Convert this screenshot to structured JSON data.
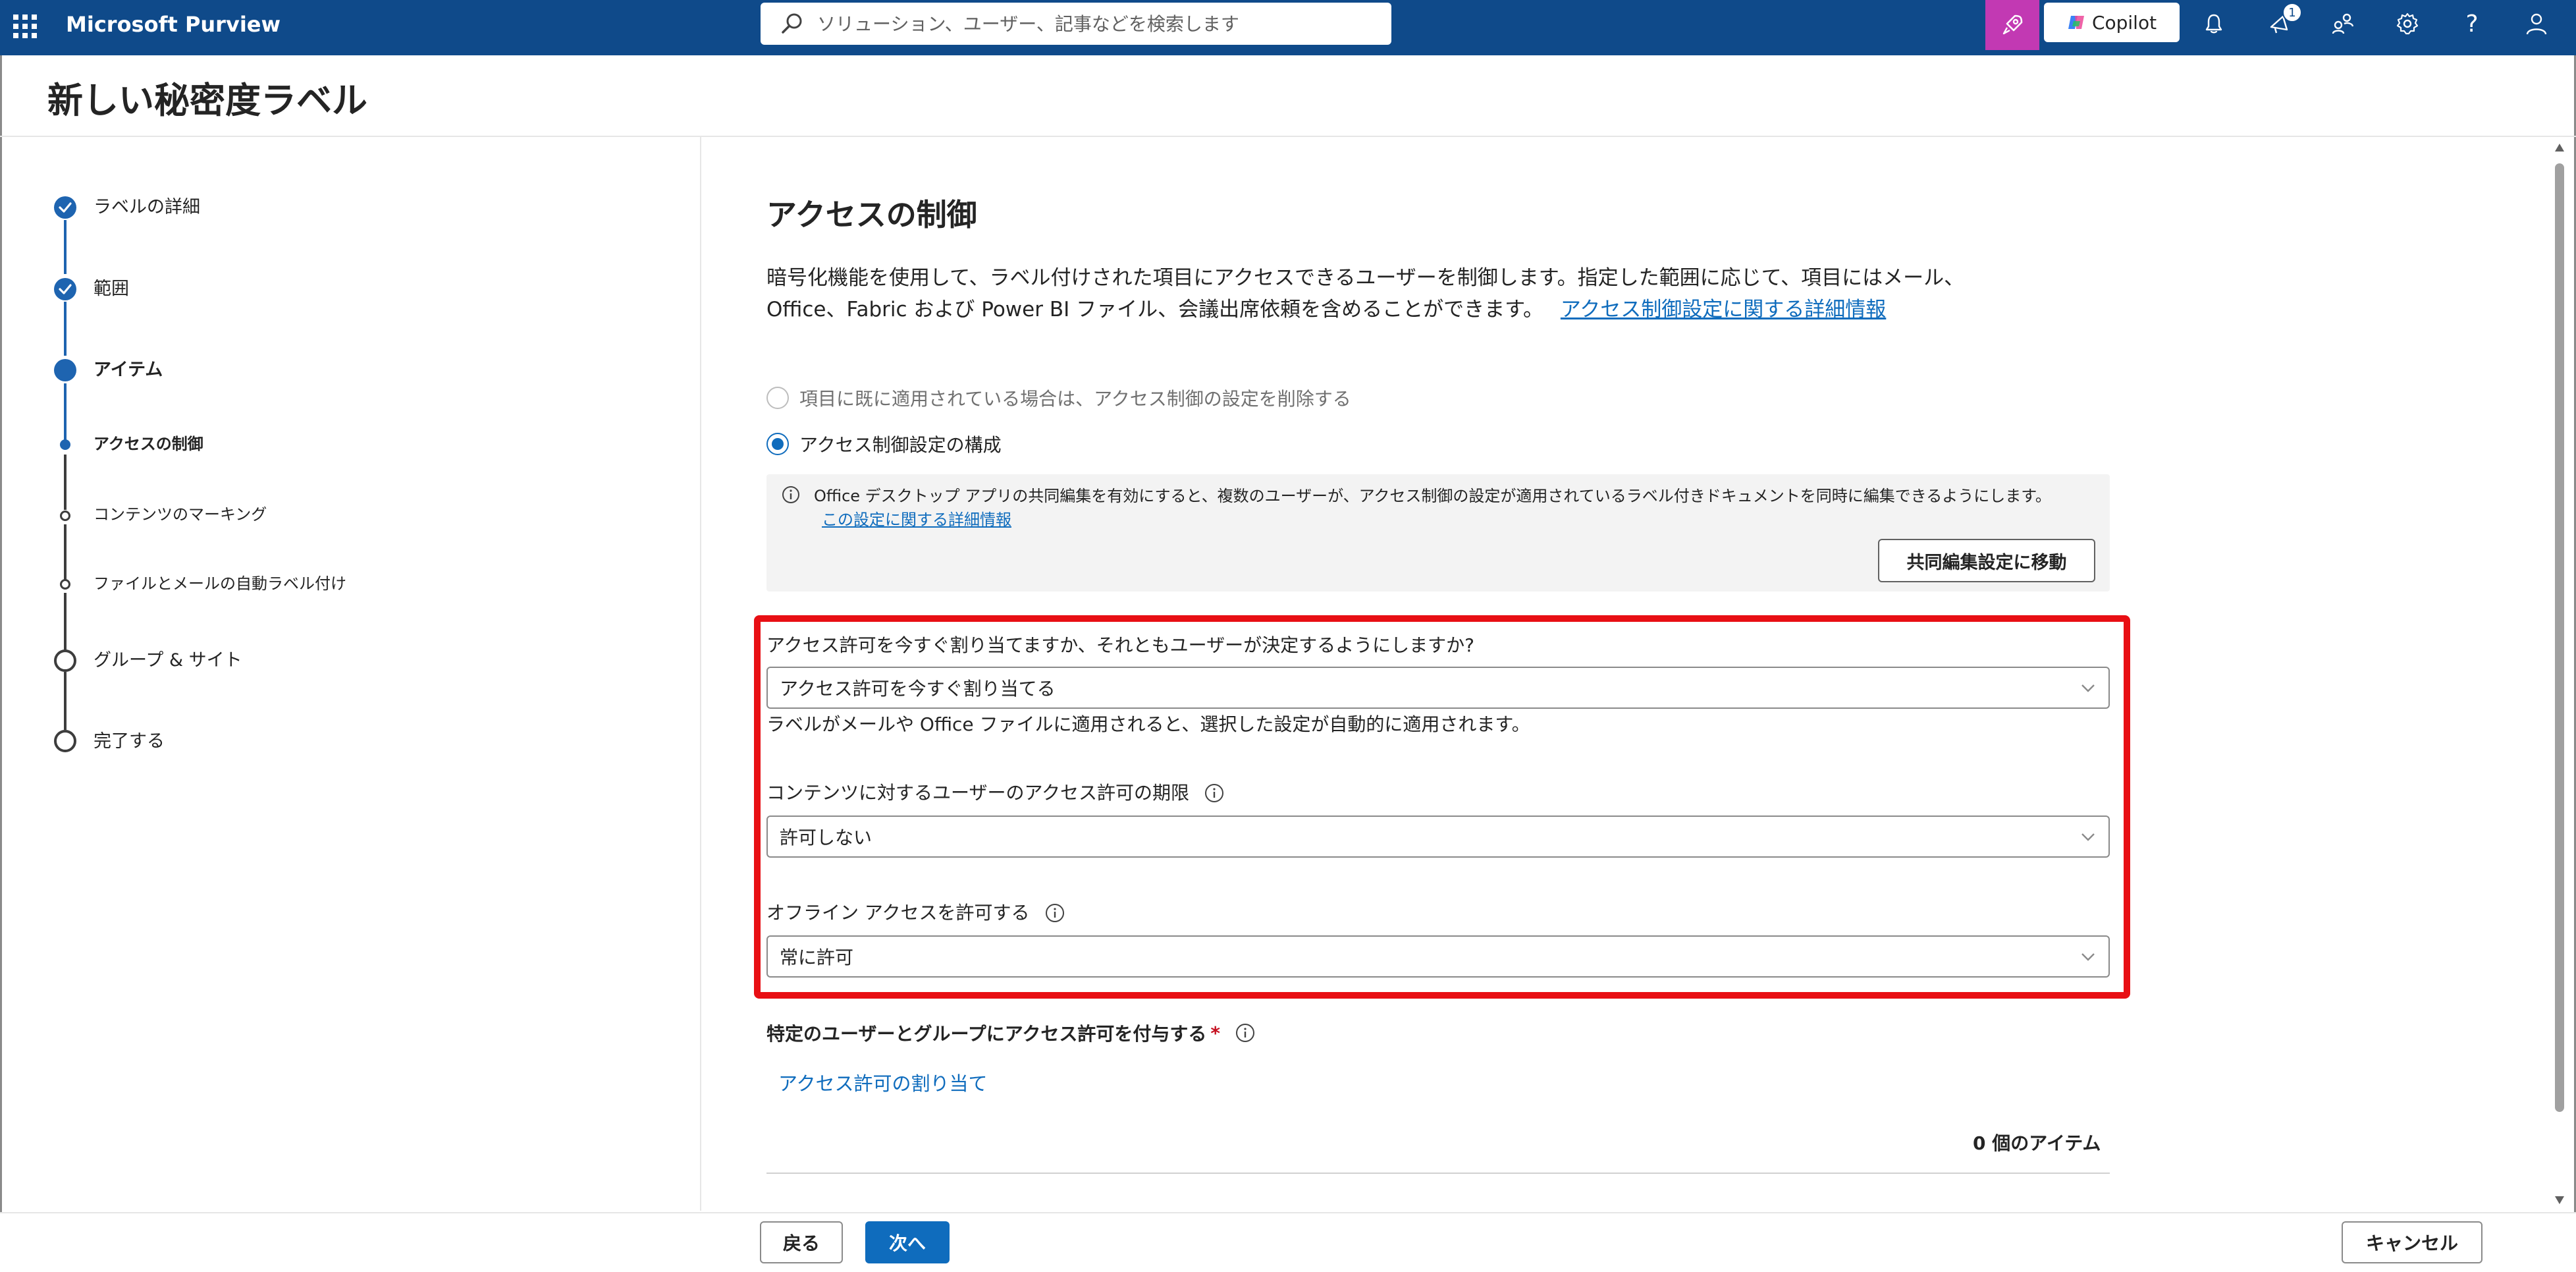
{
  "app": {
    "brand": "Microsoft Purview",
    "search_placeholder": "ソリューション、ユーザー、記事などを検索します",
    "copilot_label": "Copilot",
    "notification_count": "1",
    "colors": {
      "header": "#0f4a8a",
      "accent": "#0f6cbd",
      "highlight": "#e80f14",
      "copilot_button": "#c239b3"
    }
  },
  "page": {
    "title": "新しい秘密度ラベル"
  },
  "steps": [
    {
      "label": "ラベルの詳細",
      "state": "complete"
    },
    {
      "label": "範囲",
      "state": "complete"
    },
    {
      "label": "アイテム",
      "state": "current"
    },
    {
      "label": "アクセスの制御",
      "state": "current-sub"
    },
    {
      "label": "コンテンツのマーキング",
      "state": "pending-sub"
    },
    {
      "label": "ファイルとメールの自動ラベル付け",
      "state": "pending-sub"
    },
    {
      "label": "グループ & サイト",
      "state": "pending"
    },
    {
      "label": "完了する",
      "state": "pending"
    }
  ],
  "main": {
    "section_title": "アクセスの制御",
    "description_line1": "暗号化機能を使用して、ラベル付けされた項目にアクセスできるユーザーを制御します。指定した範囲に応じて、項目にはメール、",
    "description_line2": "Office、Fabric および Power BI ファイル、会議出席依頼を含めることができます。",
    "description_link": "アクセス制御設定に関する詳細情報",
    "radio_remove": "項目に既に適用されている場合は、アクセス制御の設定を削除する",
    "radio_configure": "アクセス制御設定の構成",
    "info_text": "Office デスクトップ アプリの共同編集を有効にすると、複数のユーザーが、アクセス制御の設定が適用されているラベル付きドキュメントを同時に編集できるようにします。",
    "info_link": "この設定に関する詳細情報",
    "coedit_button": "共同編集設定に移動",
    "assign_question": "アクセス許可を今すぐ割り当てますか、それともユーザーが決定するようにしますか?",
    "assign_value": "アクセス許可を今すぐ割り当てる",
    "assign_helper": "ラベルがメールや Office ファイルに適用されると、選択した設定が自動的に適用されます。",
    "expiry_label": "コンテンツに対するユーザーのアクセス許可の期限",
    "expiry_value": "許可しない",
    "offline_label": "オフライン アクセスを許可する",
    "offline_value": "常に許可",
    "grant_label": "特定のユーザーとグループにアクセス許可を付与する",
    "required_mark": "*",
    "assign_link": "アクセス許可の割り当て",
    "item_count": "0 個のアイテム"
  },
  "footer": {
    "back": "戻る",
    "next": "次へ",
    "cancel": "キャンセル"
  }
}
